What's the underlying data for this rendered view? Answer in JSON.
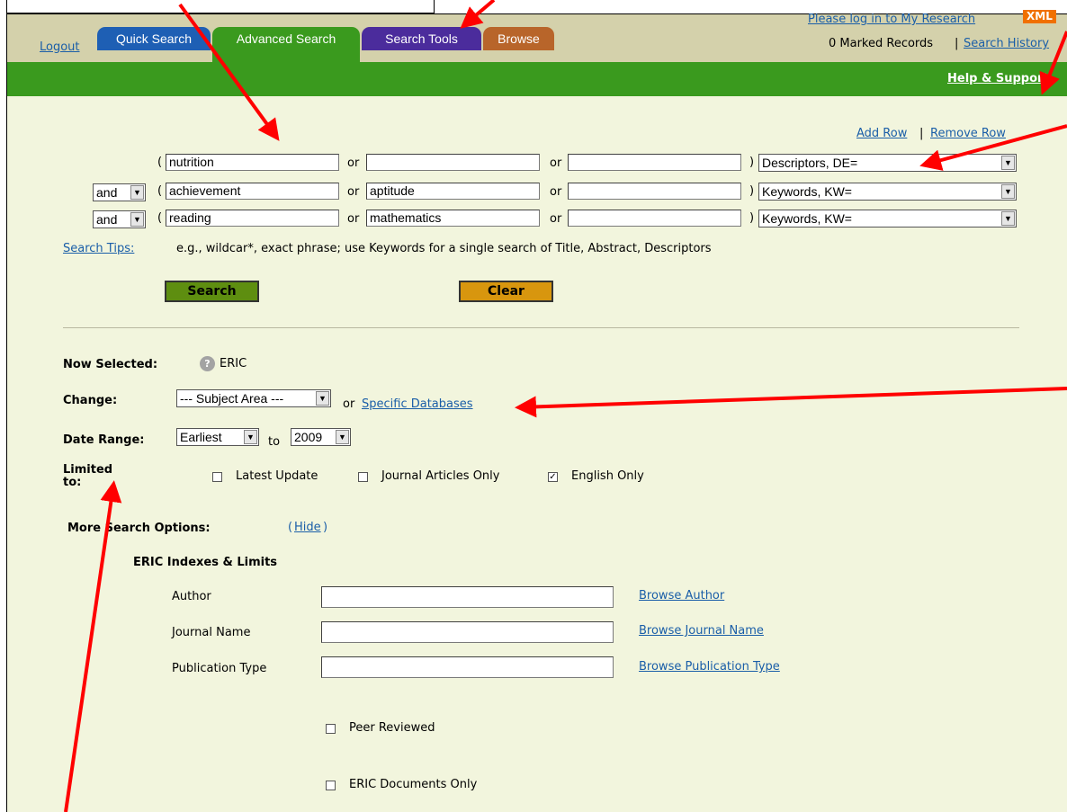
{
  "colors": {
    "quick_tab": "#1e5fb4",
    "advanced_tab": "#3a9a1e",
    "tools_tab": "#4b2c9c",
    "browse_tab": "#b8652a",
    "green_bar": "#3a9a1e",
    "page_bg": "#f2f5dd",
    "annotation_arrow": "#ff0000"
  },
  "header": {
    "logout": "Logout",
    "tabs": [
      "Quick Search",
      "Advanced Search",
      "Search Tools",
      "Browse"
    ],
    "login_link": "Please log in to My Research",
    "xml_badge": "XML",
    "marked_records": "0 Marked Records",
    "separator": "|",
    "search_history": "Search History",
    "help_support": "Help & Support"
  },
  "search_form": {
    "add_row": "Add Row",
    "row_sep": "|",
    "remove_row": "Remove Row",
    "open_paren": "(",
    "close_paren": ")",
    "or": "or",
    "rows": [
      {
        "operator": "",
        "terms": [
          "nutrition",
          "",
          ""
        ],
        "field": "Descriptors, DE="
      },
      {
        "operator": "and",
        "terms": [
          "achievement",
          "aptitude",
          ""
        ],
        "field": "Keywords, KW="
      },
      {
        "operator": "and",
        "terms": [
          "reading",
          "mathematics",
          ""
        ],
        "field": "Keywords, KW="
      }
    ],
    "tips_link": "Search Tips:",
    "tips_text": "e.g., wildcar*, exact phrase; use Keywords for a single search of Title, Abstract, Descriptors",
    "search_button": "Search",
    "clear_button": "Clear"
  },
  "options": {
    "now_selected_label": "Now Selected:",
    "help_icon": "?",
    "now_selected_value": "ERIC",
    "change_label": "Change:",
    "subject_area": "--- Subject Area ---",
    "or": "or",
    "specific_databases": "Specific Databases",
    "date_range_label": "Date Range:",
    "date_from": "Earliest",
    "date_to_word": "to",
    "date_to": "2009",
    "limited_label": "Limited to:",
    "limits": [
      {
        "label": "Latest Update",
        "checked": false
      },
      {
        "label": "Journal Articles Only",
        "checked": false
      },
      {
        "label": "English Only",
        "checked": true
      }
    ],
    "check_mark": "✓",
    "more_options_label": "More Search Options:",
    "hide_open": "(",
    "hide_link": "Hide",
    "hide_close": ")"
  },
  "eric": {
    "heading": "ERIC Indexes & Limits",
    "fields": [
      {
        "label": "Author",
        "value": "",
        "browse": "Browse Author"
      },
      {
        "label": "Journal Name",
        "value": "",
        "browse": "Browse Journal Name"
      },
      {
        "label": "Publication Type",
        "value": "",
        "browse": "Browse Publication Type"
      }
    ],
    "peer_reviewed": "Peer Reviewed",
    "eric_documents_only": "ERIC Documents Only"
  }
}
